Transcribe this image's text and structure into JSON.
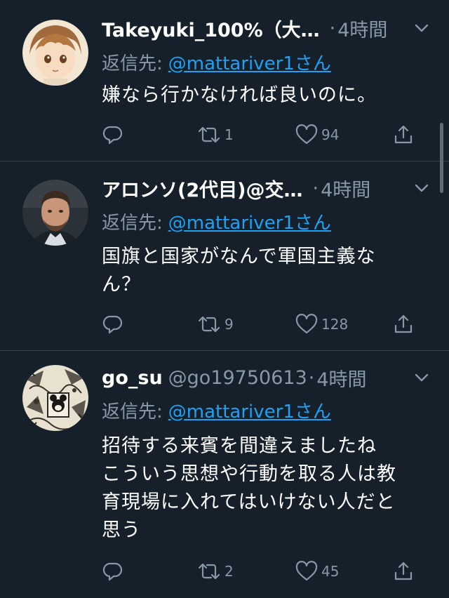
{
  "tweets": [
    {
      "name": "Takeyuki_100%（大…",
      "handle": "",
      "separator": "·",
      "time": "4時間",
      "reply_label": "返信先:",
      "reply_mention": "@mattariver1さん",
      "body_lines": [
        "嫌なら行かなければ良いのに。"
      ],
      "retweets": "1",
      "likes": "94",
      "avatar": "anime-boy-avatar"
    },
    {
      "name": "アロンソ(2代目)@交…",
      "handle": "",
      "separator": "·",
      "time": "4時間",
      "reply_label": "返信先:",
      "reply_mention": "@mattariver1さん",
      "body_lines": [
        "国旗と国家がなんで軍国主義な",
        "ん？"
      ],
      "retweets": "9",
      "likes": "128",
      "avatar": "photo-man-avatar"
    },
    {
      "name": "go_su",
      "handle": "@go19750613",
      "separator": "·",
      "time": "4時間",
      "reply_label": "返信先:",
      "reply_mention": "@mattariver1さん",
      "body_lines": [
        "招待する来賓を間違えましたね",
        "こういう思想や行動を取る人は教",
        "育現場に入れてはいけない人だと",
        "思う"
      ],
      "retweets": "2",
      "likes": "45",
      "avatar": "manga-collage-avatar"
    }
  ],
  "colors": {
    "background": "#15202b",
    "divider": "#38444d",
    "secondary_text": "#8899a6",
    "link": "#1da1f2"
  },
  "icons": [
    "reply-icon",
    "retweet-icon",
    "like-icon",
    "share-icon",
    "chevron-down-icon"
  ]
}
